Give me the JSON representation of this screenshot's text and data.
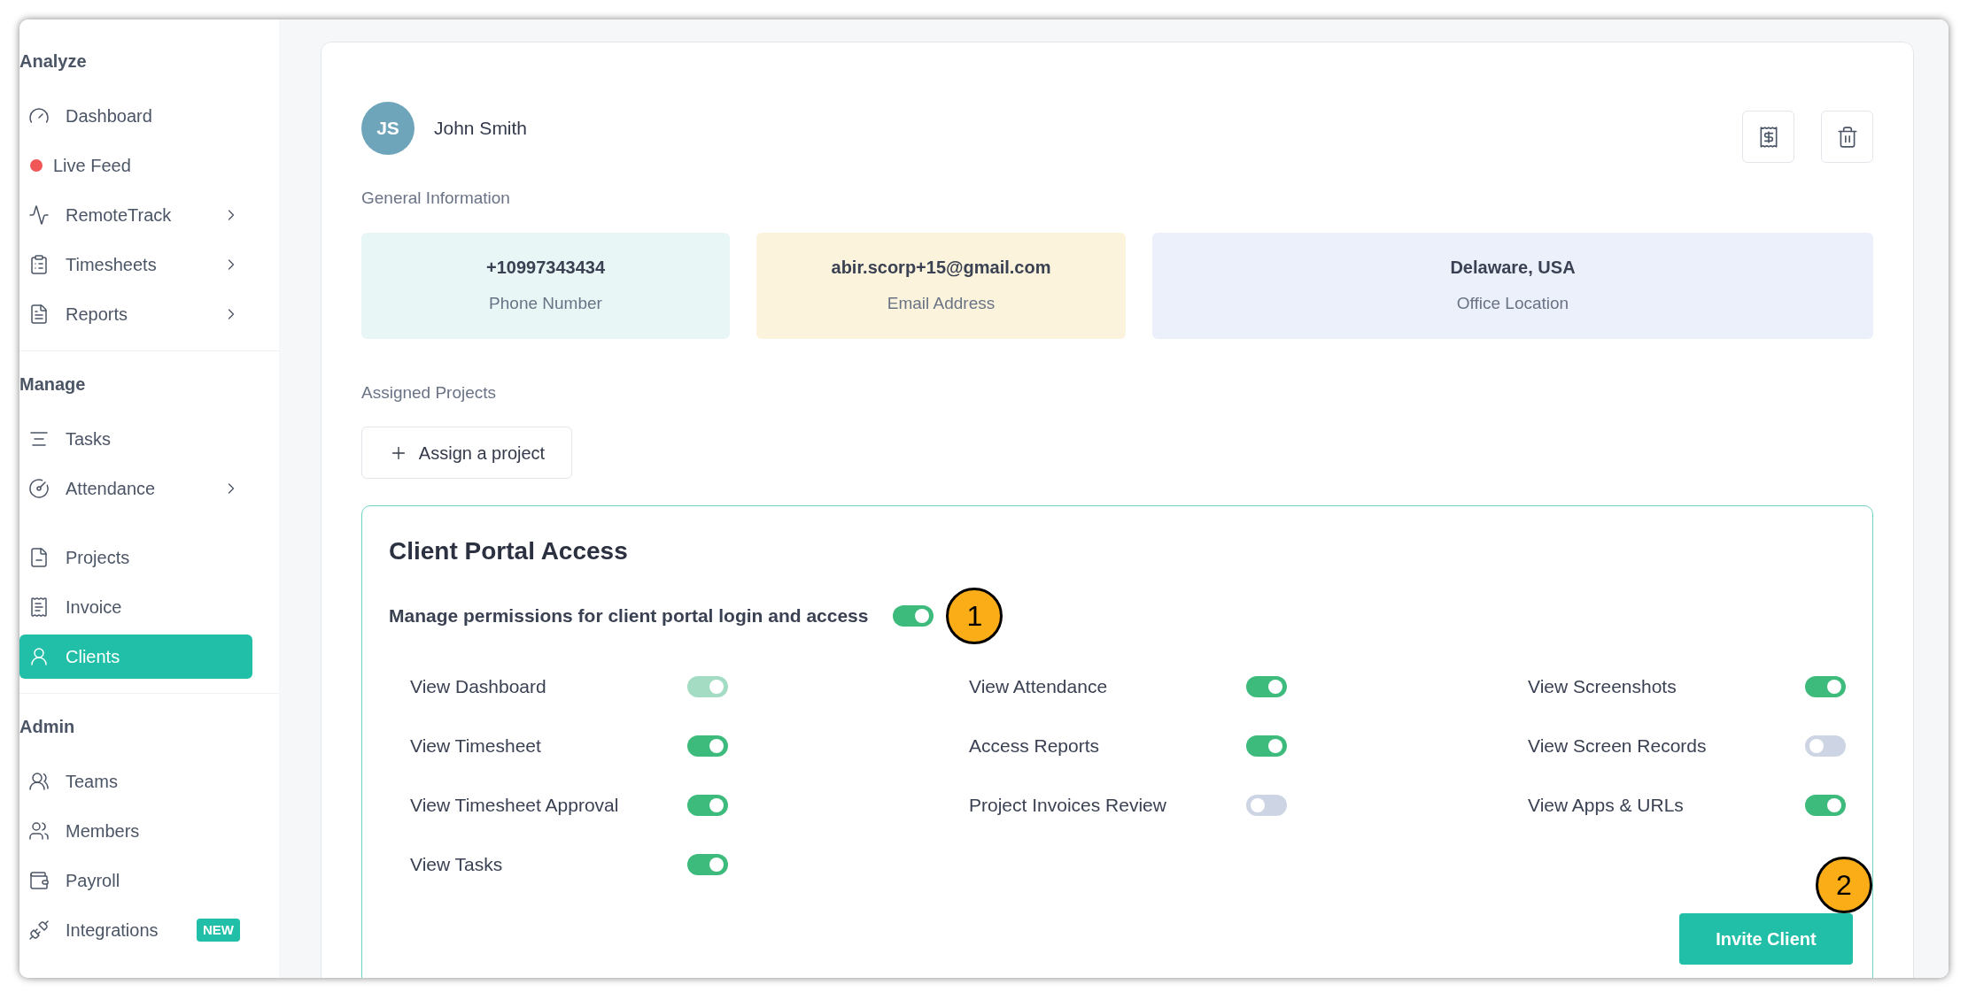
{
  "sidebar": {
    "sections": [
      {
        "title": "Analyze",
        "items": [
          {
            "label": "Dashboard",
            "chevron": false,
            "selected": false
          },
          {
            "label": "Live Feed",
            "chevron": false,
            "selected": false
          },
          {
            "label": "RemoteTrack",
            "chevron": true,
            "selected": false
          },
          {
            "label": "Timesheets",
            "chevron": true,
            "selected": false
          },
          {
            "label": "Reports",
            "chevron": true,
            "selected": false
          }
        ]
      },
      {
        "title": "Manage",
        "items": [
          {
            "label": "Tasks",
            "chevron": false,
            "selected": false
          },
          {
            "label": "Attendance",
            "chevron": true,
            "selected": false
          },
          {
            "label": "Projects",
            "chevron": false,
            "selected": false
          },
          {
            "label": "Invoice",
            "chevron": false,
            "selected": false
          },
          {
            "label": "Clients",
            "chevron": false,
            "selected": true
          }
        ]
      },
      {
        "title": "Admin",
        "items": [
          {
            "label": "Teams",
            "chevron": false,
            "selected": false
          },
          {
            "label": "Members",
            "chevron": false,
            "selected": false
          },
          {
            "label": "Payroll",
            "chevron": false,
            "selected": false
          },
          {
            "label": "Integrations",
            "chevron": false,
            "selected": false,
            "badge": "NEW"
          }
        ]
      }
    ]
  },
  "client": {
    "initials": "JS",
    "name": "John Smith"
  },
  "general_information": {
    "title": "General Information",
    "fields": [
      {
        "value": "+10997343434",
        "label": "Phone Number",
        "color": "#e8f6f6"
      },
      {
        "value": "abir.scorp+15@gmail.com",
        "label": "Email Address",
        "color": "#fbf3dc"
      },
      {
        "value": "Delaware, USA",
        "label": "Office Location",
        "color": "#ebf0fb"
      }
    ]
  },
  "assigned_projects": {
    "title": "Assigned Projects",
    "button": "Assign a project"
  },
  "portal": {
    "title": "Client Portal Access",
    "master": {
      "label": "Manage permissions for client portal login and access",
      "on": true
    },
    "columns": [
      [
        {
          "label": "View Dashboard",
          "on": true,
          "disabled": true
        },
        {
          "label": "View Timesheet",
          "on": true,
          "disabled": false
        },
        {
          "label": "View Timesheet Approval",
          "on": true,
          "disabled": false
        },
        {
          "label": "View Tasks",
          "on": true,
          "disabled": false
        }
      ],
      [
        {
          "label": "View Attendance",
          "on": true,
          "disabled": false
        },
        {
          "label": "Access Reports",
          "on": true,
          "disabled": false
        },
        {
          "label": "Project Invoices Review",
          "on": false,
          "disabled": false
        }
      ],
      [
        {
          "label": "View Screenshots",
          "on": true,
          "disabled": false
        },
        {
          "label": "View Screen Records",
          "on": false,
          "disabled": false
        },
        {
          "label": "View Apps & URLs",
          "on": true,
          "disabled": false
        }
      ]
    ],
    "invite_button": "Invite Client"
  },
  "annotations": [
    {
      "label": "1"
    },
    {
      "label": "2"
    }
  ]
}
